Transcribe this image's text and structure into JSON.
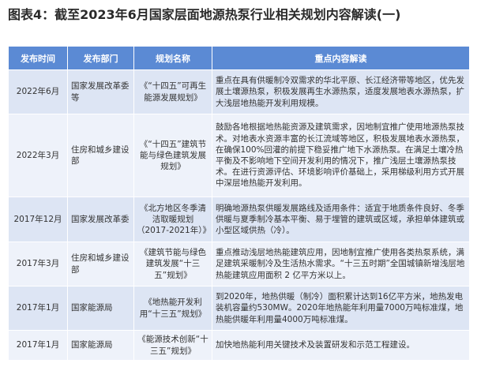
{
  "title": "图表4：截至2023年6月国家层面地源热泵行业相关规划内容解读(一)",
  "columns": [
    "发布时间",
    "发布部门",
    "规划名称",
    "重点内容解读"
  ],
  "rows": [
    {
      "time": "2022年6月",
      "dept": "国家发展改革委等",
      "plan": "《“十四五”可再生能源发展规划》",
      "content": "重点在具有供暖制冷双需求的华北平原、长江经济带等地区，优先发展土壤源热泵，积极发展再生水源热泵，适度发展地表水源热泵，扩大浅层地热能开发利用规模。"
    },
    {
      "time": "2022年3月",
      "dept": "住房和城乡建设部",
      "plan": "《“十四五”建筑节能与绿色建筑发展规划》",
      "content": "鼓励各地根据地热能资源及建筑需求，因地制宜推广使用地源热泵技术。对地表水资源丰富的长江流域等地区，积极发展地表水源热泵，在确保100%回灌的前提下稳妥推广地下水源热泵。在满足土壤冷热平衡及不影响地下空间开发利用的情况下，推广浅层土壤源热泵技术。在进行资源评估、环境影响评价基础上，采用梯级利用方式开展中深层地热能开发利用。"
    },
    {
      "time": "2017年12月",
      "dept": "国家发展改革委",
      "plan": "《北方地区冬季清洁取暖规划（2017-2021年）》",
      "content": "明确地源热泵供暖发展路线及适用条件：适宜于地质条件良好、冬季供暖与夏季制冷基本平衡、易于埋管的建筑或区域，承担单体建筑或小型区域供热（冷）。"
    },
    {
      "time": "2017年3月",
      "dept": "住房和城乡建设部",
      "plan": "《建筑节能与绿色建筑发展“十三五”规划》",
      "content": "重点推动浅层地热能建筑应用，因地制宜推广使用各类热泵系统，满足建筑采暖制冷及生活热水需求。“十三五时期”全国城镇新增浅层地热能建筑应用面积 2 亿平方米以上。"
    },
    {
      "time": "2017年1月",
      "dept": "国家能源局",
      "plan": "《地热能开发利用“十三五”规划》",
      "content": "到2020年，地热供暖（制冷）面积累计达到16亿平方米，地热发电装机容量约530MW。2020年地热能年利用量7000万吨标准煤，地热能供暖年利用量4000万吨标准煤。"
    },
    {
      "time": "2017年1月",
      "dept": "国家能源局",
      "plan": "《能源技术创新“十三五”规划》",
      "content": "加快地热能利用关键技术及装置研发和示范工程建设。"
    }
  ]
}
